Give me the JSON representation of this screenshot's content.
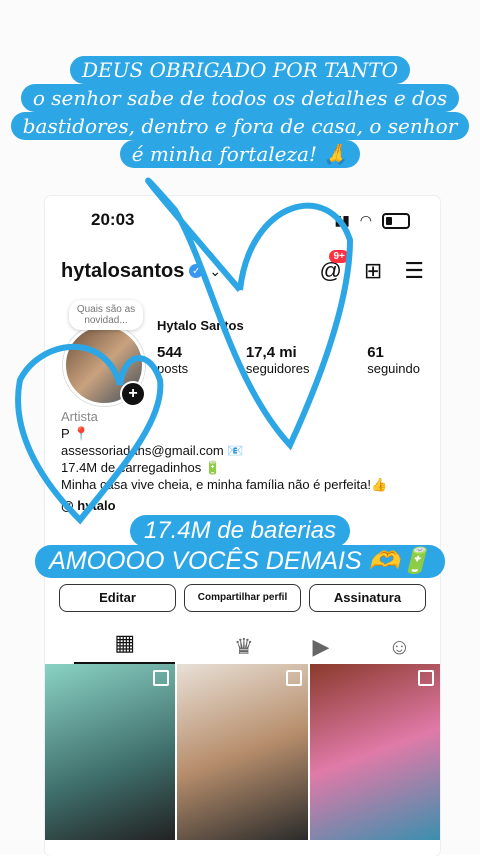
{
  "caption_top": [
    "DEUS OBRIGADO POR TANTO",
    "o senhor sabe de todos os detalhes e dos",
    "bastidores, dentro e fora de casa, o senhor",
    "é minha fortaleza! 🙏"
  ],
  "status_bar": {
    "time": "20:03"
  },
  "header": {
    "username": "hytalosantos",
    "threads_badge": "9+"
  },
  "note": "Quais são as novidad...",
  "profile": {
    "full_name": "Hytalo Santos",
    "posts": {
      "num": "544",
      "label": "posts"
    },
    "followers": {
      "num": "17,4 mi",
      "label": "seguidores"
    },
    "following": {
      "num": "61",
      "label": "seguindo"
    },
    "category": "Artista",
    "bio_line1": "P 📍",
    "bio_line2": "assessoriadahs@gmail.com 📧",
    "bio_line3": "17.4M de carregadinhos 🔋",
    "bio_line4": "Minha casa vive cheia, e minha família não é perfeita!👍",
    "handle": "@ hytalo"
  },
  "buttons": {
    "edit": "Editar",
    "share": "Compartilhar perfil",
    "subscribe": "Assinatura"
  },
  "caption_bottom": {
    "line1": "17.4M de baterias",
    "line2": "AMOOOO VOCÊS DEMAIS 🫶🔋"
  },
  "colors": {
    "caption_bg": "#2da6e6",
    "badge": "#ff3040",
    "verified": "#3897f0"
  }
}
